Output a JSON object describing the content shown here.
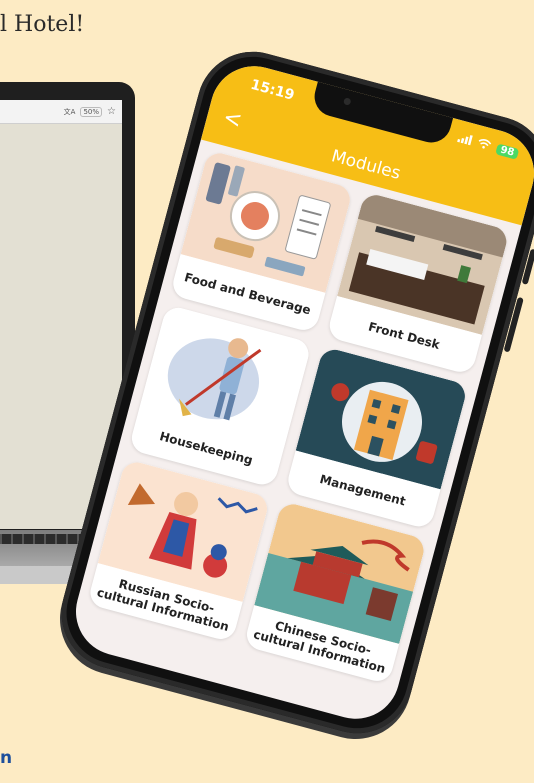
{
  "background": {
    "heading": "l Hotel!",
    "footer": "n"
  },
  "laptop": {
    "toolbar_translate": "文A",
    "toolbar_zoom": "50%",
    "toolbar_star": "☆"
  },
  "status_bar": {
    "time": "15:19",
    "battery": "98"
  },
  "app": {
    "title": "Modules",
    "back": "<",
    "accent": "#f7be15"
  },
  "modules": [
    {
      "label": "Food and Beverage"
    },
    {
      "label": "Front Desk"
    },
    {
      "label": "Housekeeping"
    },
    {
      "label": "Management"
    },
    {
      "label": "Russian Socio-cultural Information"
    },
    {
      "label": "Chinese Socio-cultural Information"
    }
  ]
}
